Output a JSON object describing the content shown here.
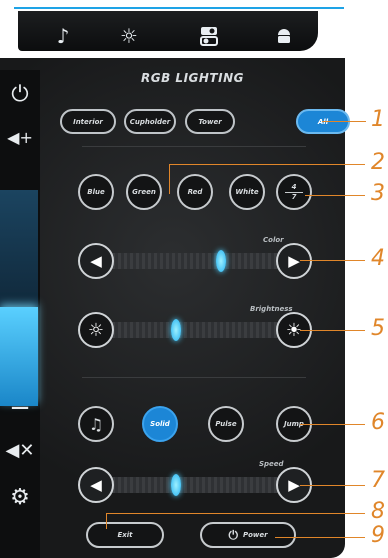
{
  "accent": "#1c86d6",
  "callout_color": "#e0862a",
  "tabs": [
    {
      "icon": "music-note-icon"
    },
    {
      "icon": "sun-icon"
    },
    {
      "icon": "toggle-icon"
    },
    {
      "icon": "android-icon"
    }
  ],
  "title": "RGB LIGHTING",
  "zones": [
    "Interior",
    "Cupholder",
    "Tower",
    "All"
  ],
  "active_zone": "All",
  "colors": [
    "Blue",
    "Green",
    "Red",
    "White"
  ],
  "pager": {
    "current": "4",
    "total": "7"
  },
  "color_label": "Color",
  "color_value": 0.66,
  "brightness_label": "Brightness",
  "brightness_value": 0.4,
  "modes": [
    "Solid",
    "Pulse",
    "Jump"
  ],
  "active_mode": "Solid",
  "speed_label": "Speed",
  "speed_value": 0.4,
  "exit_label": "Exit",
  "power_label": "Power",
  "volume_level": 0.46,
  "callouts": [
    "1",
    "2",
    "3",
    "4",
    "5",
    "6",
    "7",
    "8",
    "9"
  ]
}
